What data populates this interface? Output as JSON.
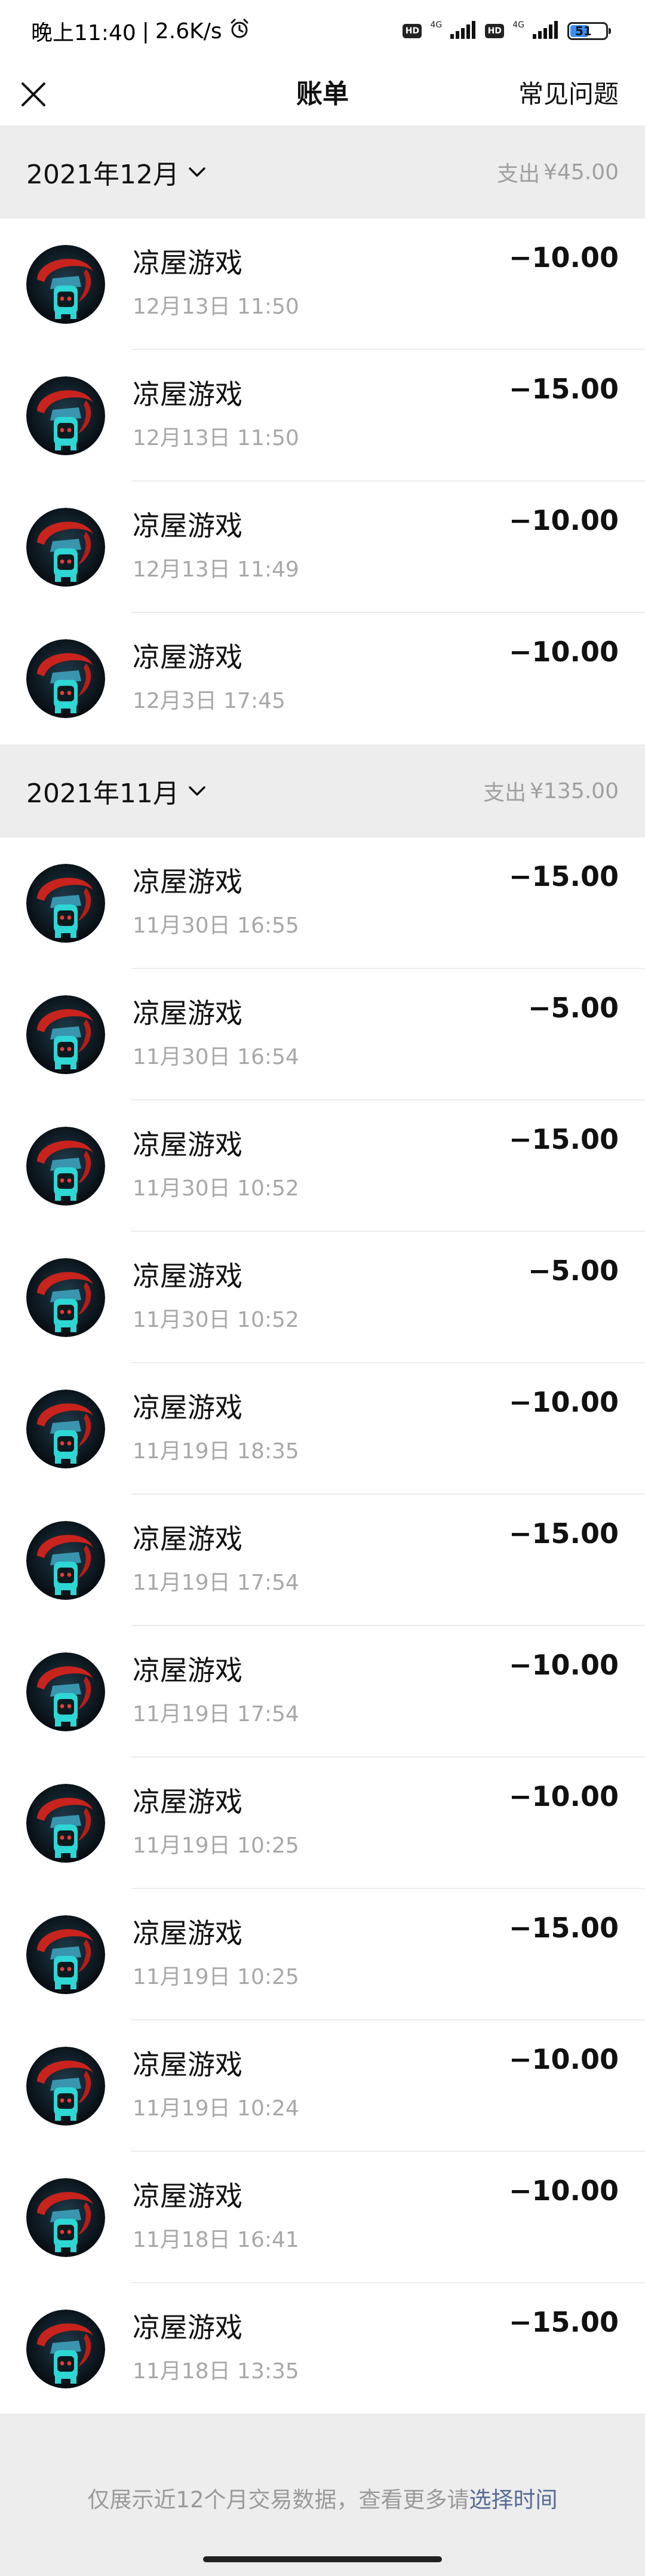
{
  "status_bar": {
    "time": "晚上11:40",
    "separator": "|",
    "speed": "2.6K/s",
    "hd1": "HD",
    "net1": "4G",
    "hd2": "HD",
    "net2": "4G",
    "battery": "51",
    "battery_level": 0.51
  },
  "nav": {
    "title": "账单",
    "faq_label": "常见问题"
  },
  "months": [
    {
      "label": "2021年12月",
      "total_prefix": "支出",
      "total_amount": "¥45.00",
      "items": [
        {
          "title": "凉屋游戏",
          "time": "12月13日 11:50",
          "amount": "−10.00"
        },
        {
          "title": "凉屋游戏",
          "time": "12月13日 11:50",
          "amount": "−15.00"
        },
        {
          "title": "凉屋游戏",
          "time": "12月13日 11:49",
          "amount": "−10.00"
        },
        {
          "title": "凉屋游戏",
          "time": "12月3日 17:45",
          "amount": "−10.00"
        }
      ]
    },
    {
      "label": "2021年11月",
      "total_prefix": "支出",
      "total_amount": "¥135.00",
      "items": [
        {
          "title": "凉屋游戏",
          "time": "11月30日 16:55",
          "amount": "−15.00"
        },
        {
          "title": "凉屋游戏",
          "time": "11月30日 16:54",
          "amount": "−5.00"
        },
        {
          "title": "凉屋游戏",
          "time": "11月30日 10:52",
          "amount": "−15.00"
        },
        {
          "title": "凉屋游戏",
          "time": "11月30日 10:52",
          "amount": "−5.00"
        },
        {
          "title": "凉屋游戏",
          "time": "11月19日 18:35",
          "amount": "−10.00"
        },
        {
          "title": "凉屋游戏",
          "time": "11月19日 17:54",
          "amount": "−15.00"
        },
        {
          "title": "凉屋游戏",
          "time": "11月19日 17:54",
          "amount": "−10.00"
        },
        {
          "title": "凉屋游戏",
          "time": "11月19日 10:25",
          "amount": "−10.00"
        },
        {
          "title": "凉屋游戏",
          "time": "11月19日 10:25",
          "amount": "−15.00"
        },
        {
          "title": "凉屋游戏",
          "time": "11月19日 10:24",
          "amount": "−10.00"
        },
        {
          "title": "凉屋游戏",
          "time": "11月18日 16:41",
          "amount": "−10.00"
        },
        {
          "title": "凉屋游戏",
          "time": "11月18日 13:35",
          "amount": "−15.00"
        }
      ]
    }
  ],
  "footer": {
    "note": "仅展示近12个月交易数据，查看更多请",
    "link": "选择时间"
  },
  "icons": {
    "close": "close-icon",
    "dropdown": "chevron-down-icon",
    "avatar": "merchant-avatar-icon",
    "alarm": "alarm-icon",
    "signal": "signal-icon",
    "battery": "battery-icon"
  },
  "colors": {
    "header_bg": "#ededed",
    "link": "#576b95",
    "muted_text": "#a8a8a8",
    "battery_fill": "#3b8df2"
  }
}
